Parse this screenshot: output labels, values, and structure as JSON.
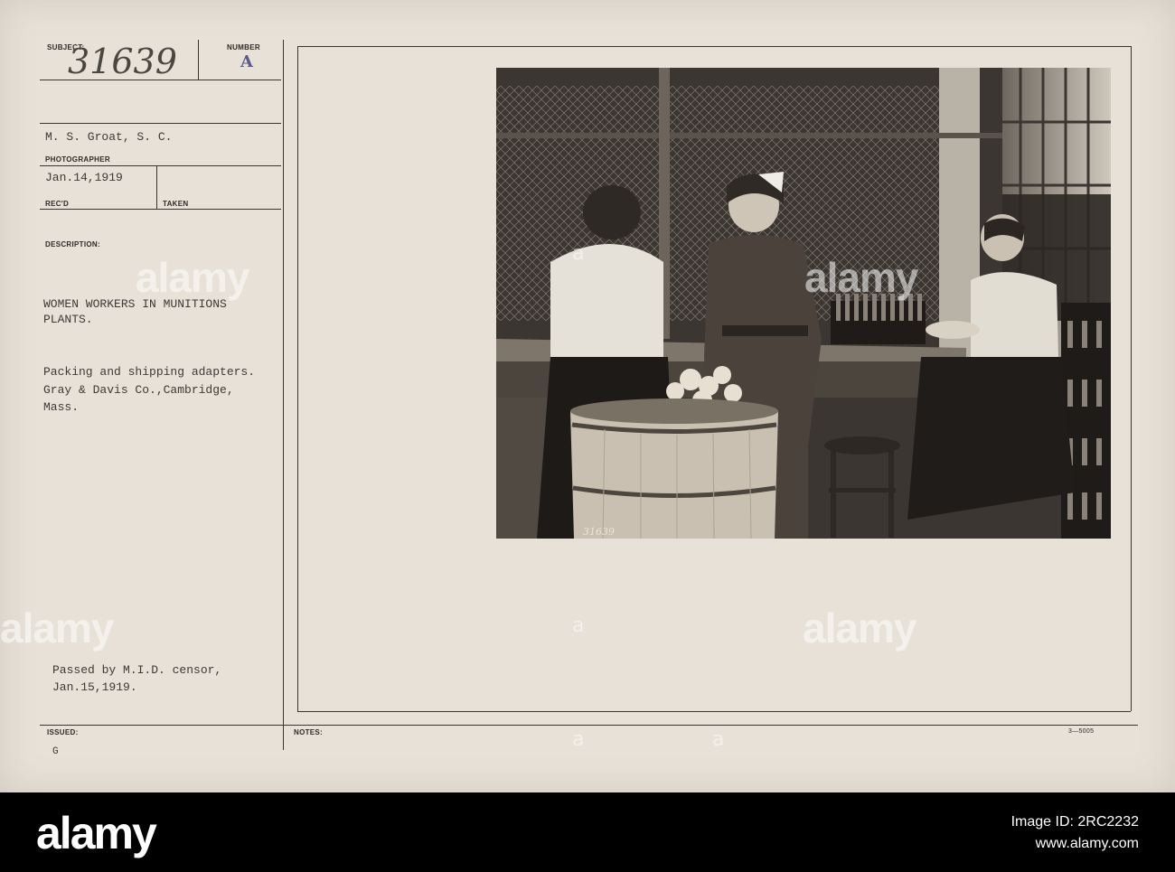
{
  "card": {
    "subject_label": "SUBJECT:",
    "subject_value": "31639",
    "number_label": "NUMBER",
    "number_value": "A",
    "photographer_name": "M. S. Groat, S. C.",
    "photographer_label": "PHOTOGRAPHER",
    "received_date": "Jan.14,1919",
    "received_label": "REC'D",
    "taken_label": "TAKEN",
    "description_label": "DESCRIPTION:",
    "description_lines": [
      "WOMEN WORKERS IN MUNITIONS",
      "PLANTS.",
      "Packing and shipping adapters.",
      "Gray & Davis Co.,Cambridge,",
      "Mass."
    ],
    "censor_lines": [
      "Passed by M.I.D. censor,",
      "Jan.15,1919."
    ],
    "issued_label": "ISSUED:",
    "issued_value": "G",
    "notes_label": "NOTES:",
    "form_number": "3—5005",
    "photo_negative_number": "31639"
  },
  "watermark": {
    "text": "alamy"
  },
  "footer": {
    "logo": "alamy",
    "image_id_line": "Image ID: 2RC2232",
    "site": "www.alamy.com"
  }
}
